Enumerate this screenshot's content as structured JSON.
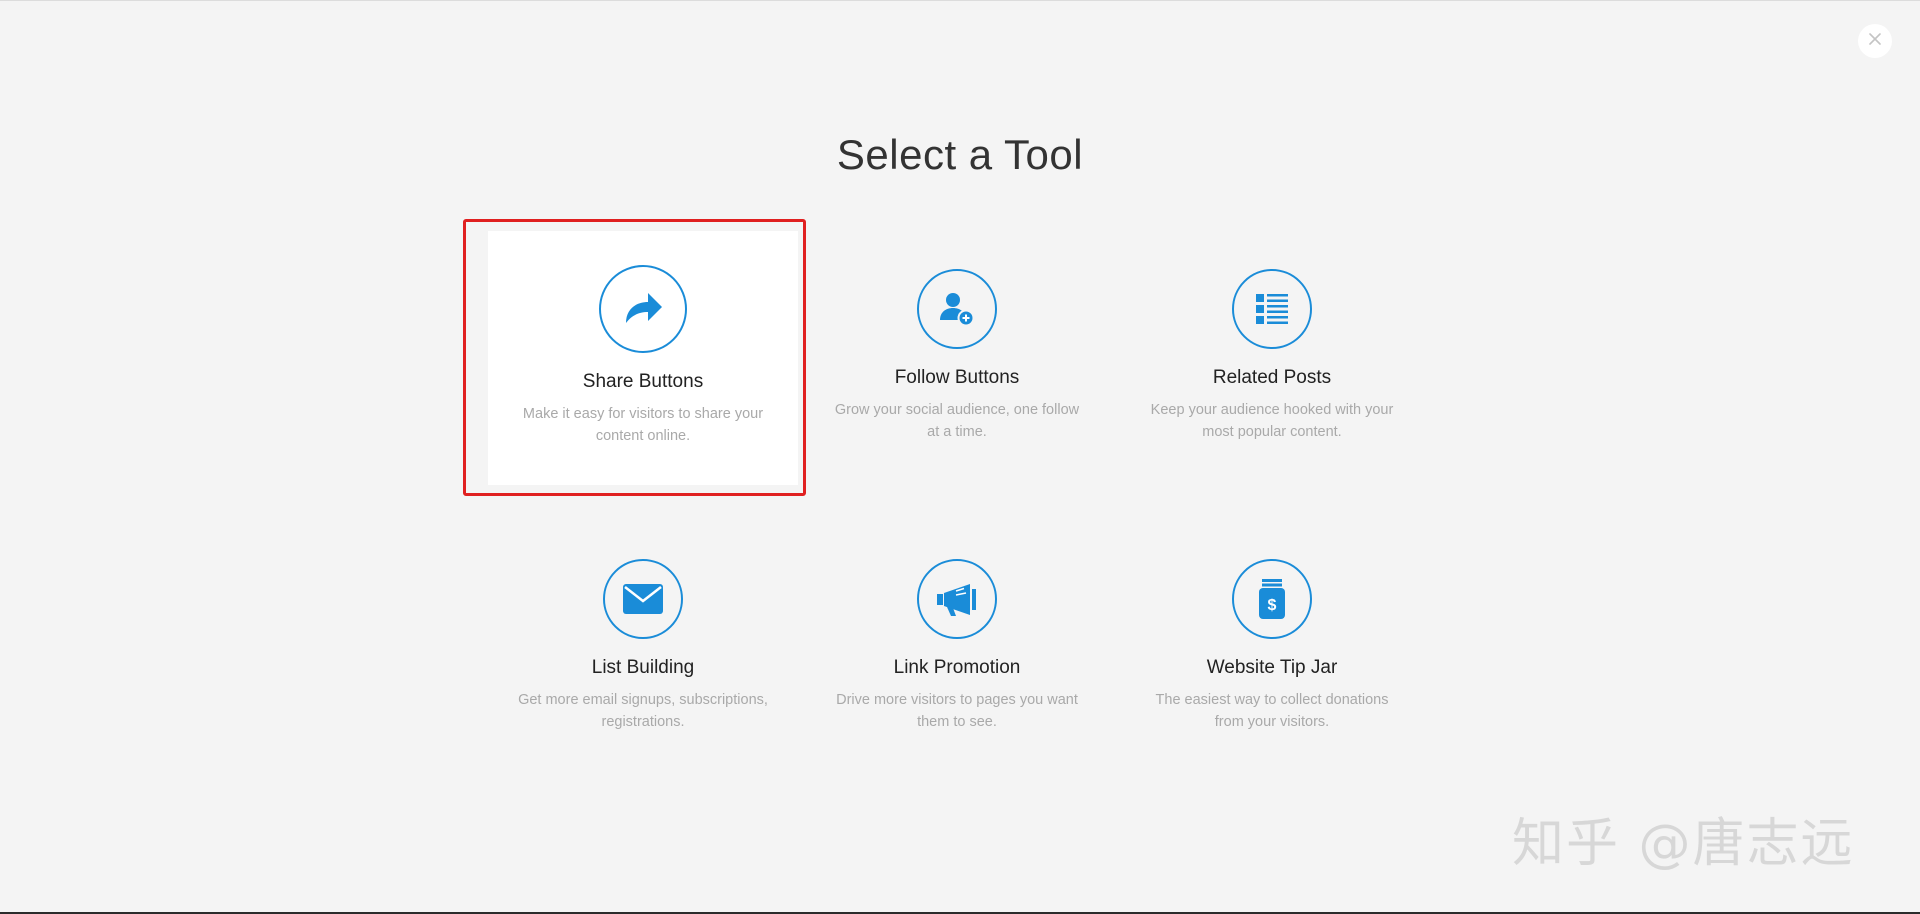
{
  "page": {
    "title": "Select a Tool"
  },
  "tools": [
    {
      "name": "Share Buttons",
      "description": "Make it easy for visitors to share your content online.",
      "icon": "share-arrow-icon",
      "selected": true
    },
    {
      "name": "Follow Buttons",
      "description": "Grow your social audience, one follow at a time.",
      "icon": "add-follower-icon",
      "selected": false
    },
    {
      "name": "Related Posts",
      "description": "Keep your audience hooked with your most popular content.",
      "icon": "list-icon",
      "selected": false
    },
    {
      "name": "List Building",
      "description": "Get more email signups, subscriptions, registrations.",
      "icon": "envelope-icon",
      "selected": false
    },
    {
      "name": "Link Promotion",
      "description": "Drive more visitors to pages you want them to see.",
      "icon": "megaphone-icon",
      "selected": false
    },
    {
      "name": "Website Tip Jar",
      "description": "The easiest way to collect donations from your visitors.",
      "icon": "tip-jar-icon",
      "selected": false
    }
  ],
  "colors": {
    "accent": "#1a8cd8",
    "background": "#f4f4f4",
    "highlight": "#e02020"
  },
  "watermark": "知乎 @唐志远"
}
